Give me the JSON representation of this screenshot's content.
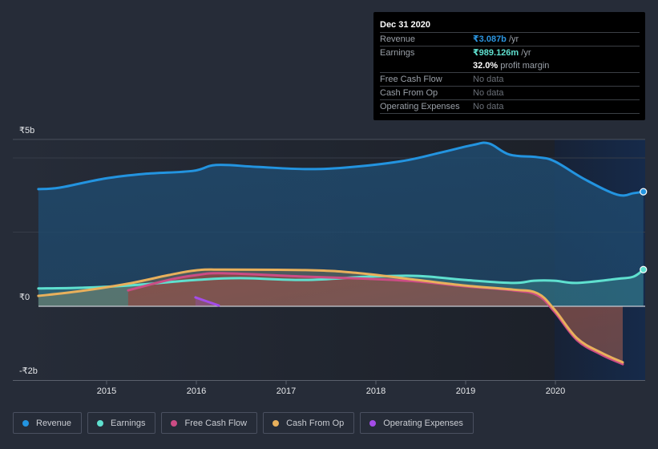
{
  "tooltip": {
    "date": "Dec 31 2020",
    "rows": [
      {
        "label": "Revenue",
        "value": "₹3.087b",
        "unit": " /yr"
      },
      {
        "label": "Earnings",
        "value": "₹989.126m",
        "unit": " /yr"
      },
      {
        "label": "",
        "value": "32.0%",
        "unit": " profit margin"
      },
      {
        "label": "Free Cash Flow",
        "value": "No data"
      },
      {
        "label": "Cash From Op",
        "value": "No data"
      },
      {
        "label": "Operating Expenses",
        "value": "No data"
      }
    ]
  },
  "legend": [
    {
      "label": "Revenue",
      "color": "#2394e0"
    },
    {
      "label": "Earnings",
      "color": "#5fe0cf"
    },
    {
      "label": "Free Cash Flow",
      "color": "#cc4c85"
    },
    {
      "label": "Cash From Op",
      "color": "#e8b05c"
    },
    {
      "label": "Operating Expenses",
      "color": "#a44ce8"
    }
  ],
  "chart_data": {
    "type": "area",
    "title": "",
    "xlabel": "",
    "ylabel": "",
    "y_unit": "₹ billions",
    "ylim": [
      -2.0,
      4.5
    ],
    "xlim": [
      2014.24,
      2021.0
    ],
    "y_tick_labels": [
      {
        "value": 4.5,
        "label": "₹5b"
      },
      {
        "value": 0,
        "label": "₹0"
      },
      {
        "value": -2,
        "label": "-₹2b"
      }
    ],
    "gridlines": [
      4,
      2,
      -2
    ],
    "x_ticks": [
      2015,
      2016,
      2017,
      2018,
      2019,
      2020
    ],
    "x_tick_labels": [
      "2015",
      "2016",
      "2017",
      "2018",
      "2019",
      "2020"
    ],
    "highlight_range": [
      2019.99,
      2021.0
    ],
    "grid": true,
    "legend_position": "bottom",
    "series": [
      {
        "name": "Revenue",
        "color": "#2394e0",
        "x": [
          2014.24,
          2014.48,
          2014.97,
          2015.42,
          2015.96,
          2016.22,
          2016.67,
          2017.21,
          2017.66,
          2018.28,
          2018.73,
          2019.08,
          2019.26,
          2019.49,
          2019.8,
          2019.99,
          2020.33,
          2020.69,
          2020.87,
          2020.98
        ],
        "values": [
          3.16,
          3.2,
          3.44,
          3.57,
          3.65,
          3.81,
          3.76,
          3.7,
          3.74,
          3.91,
          4.15,
          4.35,
          4.39,
          4.09,
          4.02,
          3.91,
          3.42,
          3.01,
          3.05,
          3.09
        ],
        "end_marker": true
      },
      {
        "name": "Earnings",
        "color": "#5fe0cf",
        "x": [
          2014.24,
          2014.71,
          2015.24,
          2016.0,
          2016.49,
          2017.21,
          2017.92,
          2018.46,
          2018.99,
          2019.53,
          2019.76,
          2019.99,
          2020.24,
          2020.69,
          2020.87,
          2020.98
        ],
        "values": [
          0.48,
          0.5,
          0.56,
          0.71,
          0.76,
          0.71,
          0.8,
          0.82,
          0.71,
          0.63,
          0.69,
          0.69,
          0.63,
          0.74,
          0.8,
          0.99
        ],
        "end_marker": true
      },
      {
        "name": "Free Cash Flow",
        "color": "#cc4c85",
        "x": [
          2015.24,
          2015.69,
          2016.0,
          2016.31,
          2017.21,
          2017.92,
          2018.46,
          2018.99,
          2019.53,
          2019.8,
          2019.99,
          2020.24,
          2020.51,
          2020.75
        ],
        "values": [
          0.43,
          0.71,
          0.84,
          0.89,
          0.8,
          0.74,
          0.67,
          0.54,
          0.43,
          0.3,
          -0.15,
          -0.91,
          -1.3,
          -1.56
        ]
      },
      {
        "name": "Cash From Op",
        "color": "#e8b05c",
        "x": [
          2014.24,
          2014.71,
          2015.24,
          2015.69,
          2016.0,
          2016.31,
          2017.3,
          2017.83,
          2018.46,
          2018.99,
          2019.53,
          2019.8,
          2019.99,
          2020.24,
          2020.51,
          2020.75
        ],
        "values": [
          0.28,
          0.41,
          0.61,
          0.84,
          0.97,
          0.99,
          0.97,
          0.89,
          0.71,
          0.56,
          0.45,
          0.35,
          -0.09,
          -0.86,
          -1.25,
          -1.51
        ]
      },
      {
        "name": "Operating Expenses",
        "color": "#a44ce8",
        "x": [
          2015.99,
          2016.25
        ],
        "values": [
          0.24,
          0.02
        ]
      }
    ]
  }
}
